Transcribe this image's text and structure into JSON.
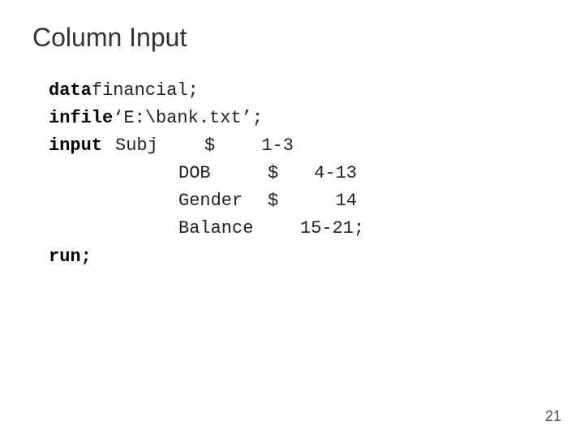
{
  "header": {
    "title": "Column Input"
  },
  "code": {
    "line1_keyword": "data",
    "line1_rest": " financial;",
    "line2_keyword": "infile",
    "line2_rest": " ‘E:\\bank.txt’;",
    "line3_keyword": "input",
    "line3_field": "Subj",
    "line3_dollar": "$",
    "line3_range": "1-3",
    "line4_field": "DOB",
    "line4_dollar": "$",
    "line4_range": "4-13",
    "line5_field": "Gender",
    "line5_dollar": "$",
    "line5_range": "14",
    "line6_field": "Balance",
    "line6_range": "15-21;",
    "line7_keyword": "run;"
  },
  "footer": {
    "page_number": "21"
  }
}
